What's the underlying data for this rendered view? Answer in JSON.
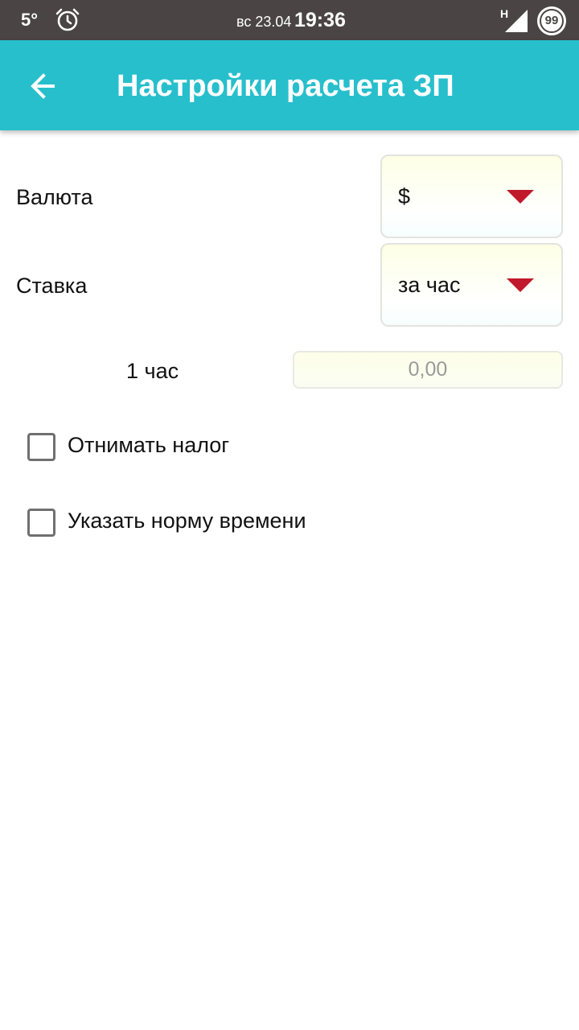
{
  "status_bar": {
    "temperature": "5°",
    "date": "вс 23.04",
    "time": "19:36",
    "network_type": "H",
    "battery": "99"
  },
  "app_bar": {
    "title": "Настройки расчета ЗП",
    "background_color": "#27bfcc"
  },
  "form": {
    "currency": {
      "label": "Валюта",
      "selected": "$"
    },
    "rate": {
      "label": "Ставка",
      "selected": "за час"
    },
    "amount": {
      "label": "1 час",
      "placeholder": "0,00"
    },
    "checkboxes": [
      {
        "label": "Отнимать налог",
        "checked": false
      },
      {
        "label": "Указать норму времени",
        "checked": false
      }
    ],
    "dropdown_arrow_color": "#c0192b"
  }
}
